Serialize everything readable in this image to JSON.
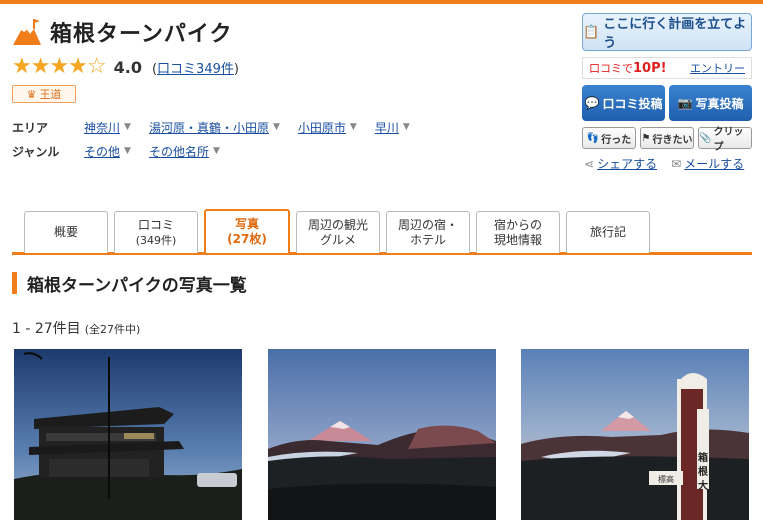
{
  "header": {
    "title": "箱根ターンパイク",
    "rating": {
      "score": "4.0",
      "stars_filled": 4,
      "stars_total": 5,
      "review_link": "口コミ349件"
    },
    "badge": "王道",
    "area_label": "エリア",
    "area_links": [
      "神奈川",
      "湯河原・真鶴・小田原",
      "小田原市",
      "早川"
    ],
    "genre_label": "ジャンル",
    "genre_links": [
      "その他",
      "その他名所"
    ]
  },
  "actions": {
    "plan_button": "ここに行く計画を立てよう",
    "points_text": "口コミで",
    "points_value": "10P!",
    "entry_link": "エントリー",
    "review_post": "口コミ投稿",
    "photo_post": "写真投稿",
    "went": "行った",
    "want": "行きたい",
    "clip": "クリップ",
    "share": "シェアする",
    "mail": "メールする"
  },
  "tabs": [
    {
      "label": "概要",
      "sub": ""
    },
    {
      "label": "口コミ",
      "sub": "(349件)"
    },
    {
      "label": "写真",
      "sub": "(27枚)"
    },
    {
      "label": "周辺の観光",
      "sub": "グルメ"
    },
    {
      "label": "周辺の宿・",
      "sub": "ホテル"
    },
    {
      "label": "宿からの",
      "sub": "現地情報"
    },
    {
      "label": "旅行記",
      "sub": ""
    }
  ],
  "section": {
    "title": "箱根ターンパイクの写真一覧"
  },
  "count": {
    "range": "1 - 27件目",
    "total": "(全27件中)"
  },
  "colors": {
    "accent": "#f07d1a",
    "link": "#1a4fa0",
    "post_button": "#2a6fc0"
  }
}
